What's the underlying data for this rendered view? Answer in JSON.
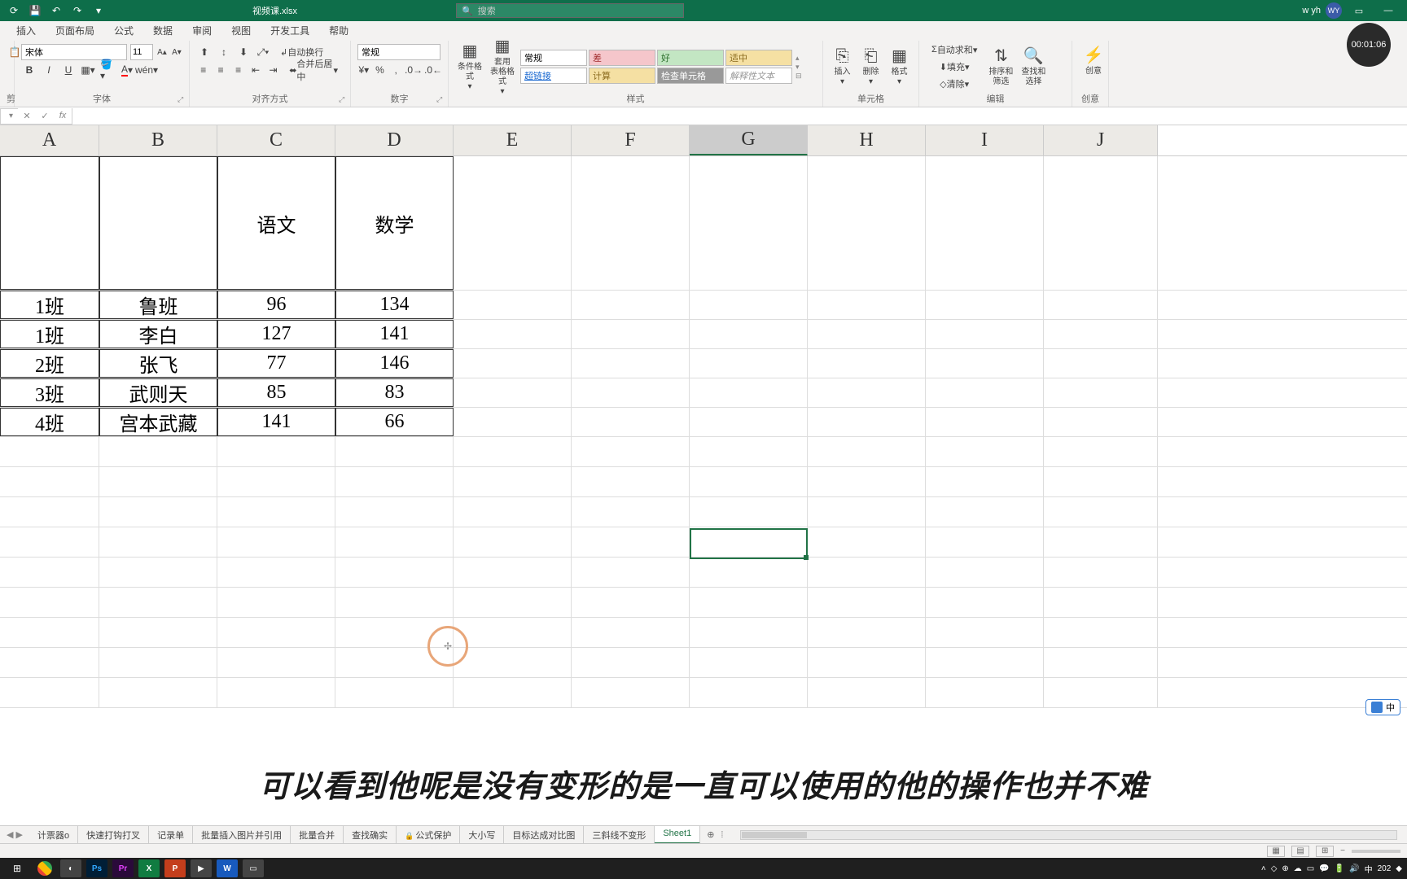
{
  "titlebar": {
    "filename": "视频课.xlsx",
    "search_placeholder": "搜索",
    "username": "w yh",
    "user_initials": "WY"
  },
  "timer": "00:01:06",
  "ribbon_tabs": [
    "插入",
    "页面布局",
    "公式",
    "数据",
    "审阅",
    "视图",
    "开发工具",
    "帮助"
  ],
  "ribbon": {
    "font": {
      "name": "宋体",
      "size": "11",
      "group_label": "字体"
    },
    "align": {
      "wrap": "自动换行",
      "merge": "合并后居中",
      "group_label": "对齐方式"
    },
    "number": {
      "format": "常规",
      "group_label": "数字"
    },
    "styles": {
      "cond_format": "条件格式",
      "table_format": "套用\n表格格式",
      "normal": "常规",
      "bad": "差",
      "good": "好",
      "medium": "适中",
      "link": "超链接",
      "calc": "计算",
      "check": "检查单元格",
      "explain": "解释性文本",
      "group_label": "样式"
    },
    "cells": {
      "insert": "插入",
      "delete": "删除",
      "format": "格式",
      "group_label": "单元格"
    },
    "editing": {
      "autosum": "自动求和",
      "fill": "填充",
      "clear": "清除",
      "sort": "排序和筛选",
      "find": "查找和选择",
      "group_label": "编辑"
    },
    "ideas": {
      "label": "创意"
    }
  },
  "grid": {
    "columns": [
      "A",
      "B",
      "C",
      "D",
      "E",
      "F",
      "G",
      "H",
      "I",
      "J"
    ],
    "headers": {
      "C": "语文",
      "D": "数学"
    },
    "rows": [
      {
        "A": "1班",
        "B": "鲁班",
        "C": "96",
        "D": "134"
      },
      {
        "A": "1班",
        "B": "李白",
        "C": "127",
        "D": "141"
      },
      {
        "A": "2班",
        "B": "张飞",
        "C": "77",
        "D": "146"
      },
      {
        "A": "3班",
        "B": "武则天",
        "C": "85",
        "D": "83"
      },
      {
        "A": "4班",
        "B": "宫本武藏",
        "C": "141",
        "D": "66"
      }
    ]
  },
  "subtitle": "可以看到他呢是没有变形的是一直可以使用的他的操作也并不难",
  "ime": "中",
  "sheet_tabs": [
    "计票器o",
    "快速打钩打叉",
    "记录单",
    "批量插入图片并引用",
    "批量合并",
    "查找确实",
    "公式保护",
    "大小写",
    "目标达成对比图",
    "三斜线不变形",
    "Sheet1"
  ],
  "active_sheet": "Sheet1",
  "protected_sheet_index": 6,
  "taskbar": {
    "tray_lang": "中",
    "clock": "202"
  }
}
